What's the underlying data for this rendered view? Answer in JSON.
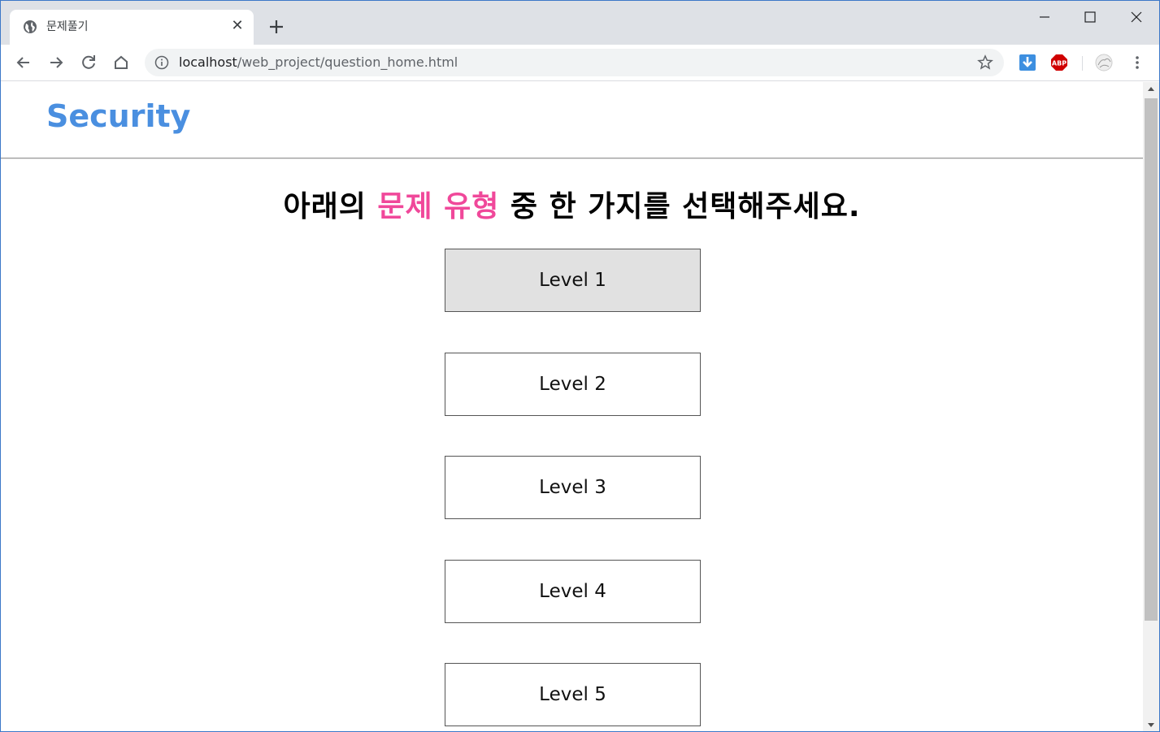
{
  "browser": {
    "tab_title": "문제풀기",
    "url_host": "localhost",
    "url_path": "/web_project/question_home.html",
    "extensions": [
      "download-icon",
      "adblock-icon",
      "profile-avatar"
    ]
  },
  "page": {
    "logo": "Security",
    "instruction": {
      "before": "아래의 ",
      "highlight": "문제 유형",
      "after": " 중 한 가지를 선택해주세요."
    },
    "levels": [
      {
        "label": "Level 1"
      },
      {
        "label": "Level 2"
      },
      {
        "label": "Level 3"
      },
      {
        "label": "Level 4"
      },
      {
        "label": "Level 5"
      }
    ]
  },
  "colors": {
    "logo": "#4a8fe0",
    "highlight": "#f0489a",
    "hover_button": "#e1e1e1"
  }
}
